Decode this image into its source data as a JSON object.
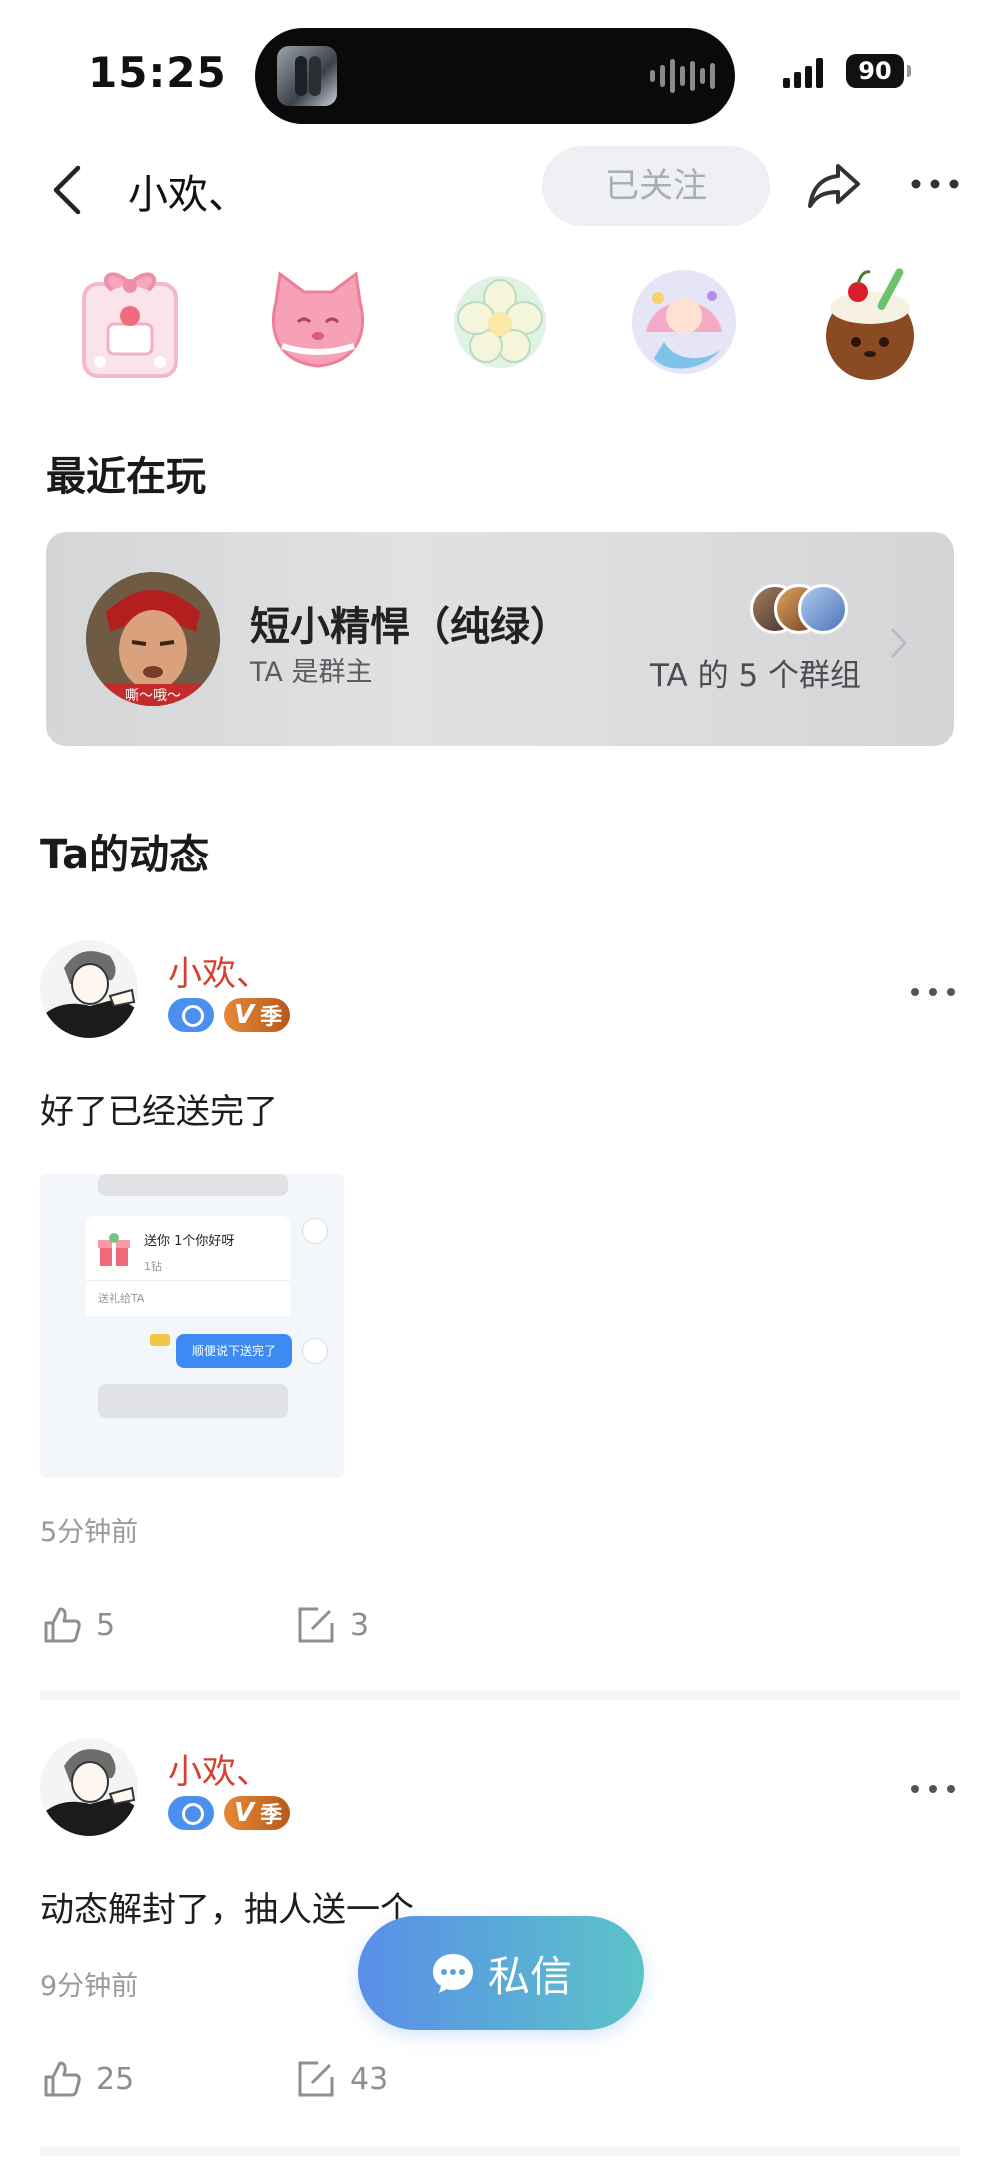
{
  "status_bar": {
    "time": "15:25",
    "battery": "90"
  },
  "nav": {
    "title": "小欢、",
    "follow_label": "已关注"
  },
  "stickers": [
    "bow-cake-sticker",
    "pink-cat-sticker",
    "flower-sticker",
    "mermaid-sticker",
    "coconut-drink-sticker"
  ],
  "recent": {
    "section_title": "最近在玩",
    "group_name": "短小精悍（纯绿）",
    "group_role": "TA 是群主",
    "group_count": "TA 的 5 个群组",
    "avatar_caption": "嘶～哦～"
  },
  "feed": {
    "section_title": "Ta的动态",
    "posts": [
      {
        "author": "小欢、",
        "vip_label": "季",
        "text": "好了已经送完了",
        "image": {
          "gift_title": "送你 1个你好呀",
          "gift_price": "1钻",
          "gift_footer": "送礼给TA",
          "reply": "顺便说下送完了"
        },
        "time": "5分钟前",
        "likes": "5",
        "comments": "3"
      },
      {
        "author": "小欢、",
        "vip_label": "季",
        "text": "动态解封了，抽人送一个",
        "time": "9分钟前",
        "likes": "25",
        "comments": "43"
      }
    ]
  },
  "dm_button": {
    "label": "私信"
  },
  "colors": {
    "author": "#d7402f",
    "accent_blue": "#4b8ff0",
    "vip_orange": "#e7893a"
  }
}
